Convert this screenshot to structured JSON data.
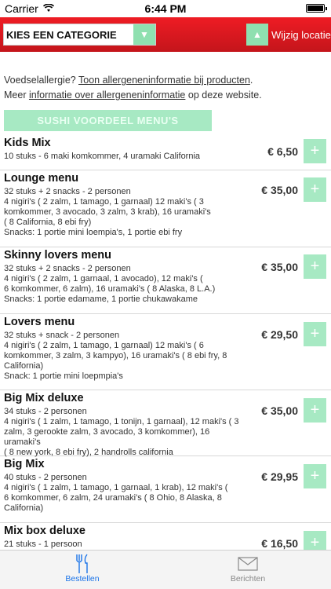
{
  "status_bar": {
    "carrier": "Carrier",
    "time": "6:44 PM"
  },
  "header": {
    "category_placeholder": "KIES EEN CATEGORIE",
    "change_location_label": "Wijzig locatie"
  },
  "info": {
    "line1_prefix": "Voedselallergie?",
    "line1_link": "Toon allergeneninformatie bij producten",
    "line1_suffix": ".",
    "line2_prefix": "Meer",
    "line2_link": "informatie over allergeneninformatie",
    "line2_suffix": "op deze website."
  },
  "section": {
    "title": "SUSHI VOORDEEL MENU'S"
  },
  "menu_items": [
    {
      "title": "Kids Mix",
      "description": "10 stuks - 6 maki komkommer, 4 uramaki California",
      "price": "€ 6,50"
    },
    {
      "title": "Lounge menu",
      "description": "32 stuks + 2 snacks - 2 personen\n4 nigiri's ( 2 zalm, 1 tamago, 1 garnaal) 12 maki's ( 3\nkomkommer, 3 avocado, 3 zalm, 3 krab), 16 uramaki's\n( 8 California, 8 ebi fry)\nSnacks: 1 portie mini loempia's, 1 portie ebi fry",
      "price": "€ 35,00"
    },
    {
      "title": "Skinny lovers menu",
      "description": "32 stuks + 2 snacks - 2 personen\n4 nigiri's ( 2 zalm, 1 garnaal, 1 avocado), 12 maki's (\n6 komkommer, 6 zalm), 16 uramaki's ( 8 Alaska, 8 L.A.)\nSnacks: 1 portie edamame, 1 portie chukawakame",
      "price": "€ 35,00"
    },
    {
      "title": "Lovers menu",
      "description": "32 stuks + snack - 2 personen\n4 nigiri's ( 2 zalm, 1 tamago, 1 garnaal) 12 maki's ( 6\nkomkommer, 3 zalm, 3 kampyo), 16 uramaki's ( 8 ebi fry, 8\nCalifornia)\nSnack: 1 portie mini loepmpia's",
      "price": "€ 29,50"
    },
    {
      "title": "Big Mix deluxe",
      "description": "34 stuks - 2 personen\n4 nigiri's ( 1 zalm, 1 tamago, 1 tonijn, 1 garnaal), 12 maki's ( 3\nzalm, 3 gerookte zalm, 3 avocado, 3 komkommer), 16 uramaki's\n( 8 new york, 8 ebi fry), 2 handrolls california",
      "price": "€ 35,00"
    },
    {
      "title": "Big Mix",
      "description": "40 stuks - 2 personen\n4 nigiri's ( 1 zalm, 1 tamago, 1 garnaal, 1 krab), 12 maki's (\n6 komkommer, 6 zalm, 24 uramaki's ( 8 Ohio, 8 Alaska, 8\nCalifornia)",
      "price": "€ 29,95"
    },
    {
      "title": "Mix box deluxe",
      "description": "21 stuks - 1 persoon",
      "price": "€ 16,50"
    }
  ],
  "tab_bar": {
    "order_label": "Bestellen",
    "messages_label": "Berichten"
  },
  "colors": {
    "header_red": "#e31b23",
    "accent_green": "#a7e9c3",
    "tab_active": "#1a73e8"
  },
  "icons": {
    "wifi": "wifi-icon",
    "battery": "battery-icon",
    "order": "cutlery-icon",
    "messages": "envelope-icon",
    "add": "plus-icon",
    "dropdown": "chevron-down-icon",
    "location": "chevron-up-icon"
  }
}
